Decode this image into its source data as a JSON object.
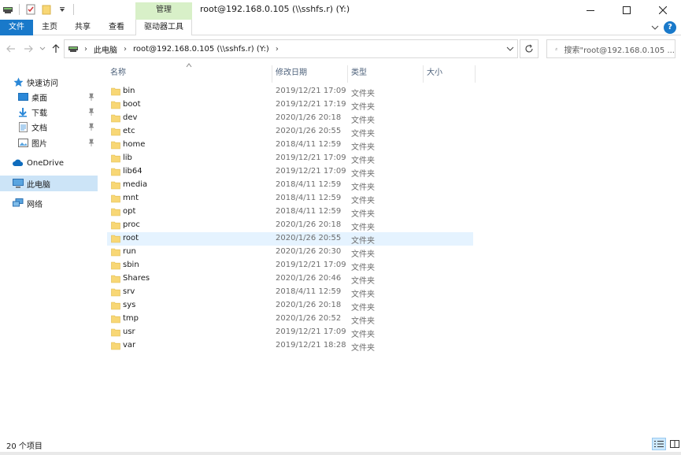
{
  "window": {
    "title": "root@192.168.0.105 (\\\\sshfs.r) (Y:)",
    "context_tab_group": "管理"
  },
  "ribbon": {
    "tabs": [
      "文件",
      "主页",
      "共享",
      "查看",
      "驱动器工具"
    ]
  },
  "address": {
    "segments": [
      "此电脑",
      "root@192.168.0.105 (\\\\sshfs.r) (Y:)"
    ],
    "search_placeholder": "搜索\"root@192.168.0.105 ..."
  },
  "nav": {
    "quick_access": "快速访问",
    "desktop": "桌面",
    "downloads": "下载",
    "documents": "文档",
    "pictures": "图片",
    "onedrive": "OneDrive",
    "this_pc": "此电脑",
    "network": "网络"
  },
  "columns": {
    "name": "名称",
    "date": "修改日期",
    "type": "类型",
    "size": "大小"
  },
  "files": [
    {
      "name": "bin",
      "date": "2019/12/21 17:09",
      "type": "文件夹"
    },
    {
      "name": "boot",
      "date": "2019/12/21 17:19",
      "type": "文件夹"
    },
    {
      "name": "dev",
      "date": "2020/1/26 20:18",
      "type": "文件夹"
    },
    {
      "name": "etc",
      "date": "2020/1/26 20:55",
      "type": "文件夹"
    },
    {
      "name": "home",
      "date": "2018/4/11 12:59",
      "type": "文件夹"
    },
    {
      "name": "lib",
      "date": "2019/12/21 17:09",
      "type": "文件夹"
    },
    {
      "name": "lib64",
      "date": "2019/12/21 17:09",
      "type": "文件夹"
    },
    {
      "name": "media",
      "date": "2018/4/11 12:59",
      "type": "文件夹"
    },
    {
      "name": "mnt",
      "date": "2018/4/11 12:59",
      "type": "文件夹"
    },
    {
      "name": "opt",
      "date": "2018/4/11 12:59",
      "type": "文件夹"
    },
    {
      "name": "proc",
      "date": "2020/1/26 20:18",
      "type": "文件夹"
    },
    {
      "name": "root",
      "date": "2020/1/26 20:55",
      "type": "文件夹"
    },
    {
      "name": "run",
      "date": "2020/1/26 20:30",
      "type": "文件夹"
    },
    {
      "name": "sbin",
      "date": "2019/12/21 17:09",
      "type": "文件夹"
    },
    {
      "name": "Shares",
      "date": "2020/1/26 20:46",
      "type": "文件夹"
    },
    {
      "name": "srv",
      "date": "2018/4/11 12:59",
      "type": "文件夹"
    },
    {
      "name": "sys",
      "date": "2020/1/26 20:18",
      "type": "文件夹"
    },
    {
      "name": "tmp",
      "date": "2020/1/26 20:52",
      "type": "文件夹"
    },
    {
      "name": "usr",
      "date": "2019/12/21 17:09",
      "type": "文件夹"
    },
    {
      "name": "var",
      "date": "2019/12/21 18:28",
      "type": "文件夹"
    }
  ],
  "hovered_file": "root",
  "status": {
    "item_count": "20 个项目"
  },
  "colors": {
    "accent": "#1979ca",
    "context_tab": "#d8f0c8",
    "folder": "#f8d775",
    "selection": "#cce4f7",
    "hover": "#e5f3ff"
  }
}
